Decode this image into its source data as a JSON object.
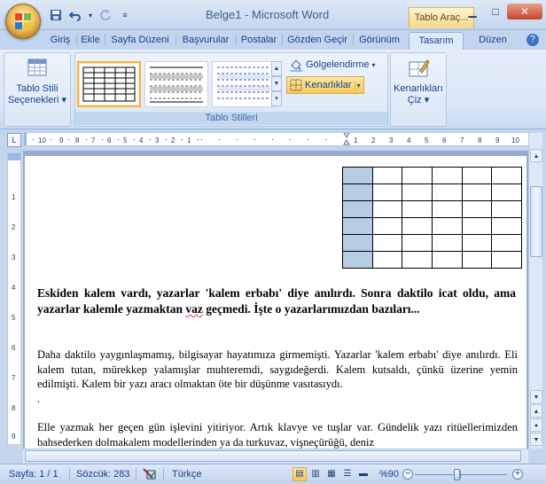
{
  "window": {
    "title": "Belge1 - Microsoft Word",
    "context_tab_group": "Tablo Araç..."
  },
  "tabs": [
    {
      "label": "Giriş"
    },
    {
      "label": "Ekle"
    },
    {
      "label": "Sayfa Düzeni"
    },
    {
      "label": "Başvurular"
    },
    {
      "label": "Postalar"
    },
    {
      "label": "Gözden Geçir"
    },
    {
      "label": "Görünüm"
    },
    {
      "label": "Tasarım",
      "active": true
    },
    {
      "label": "Düzen"
    }
  ],
  "ribbon": {
    "table_style_options_label": "Tablo Stili Seçenekleri",
    "shading_label": "Gölgelendirme",
    "borders_label": "Kenarlıklar",
    "draw_borders_label": "Kenarlıkları Çiz",
    "table_styles_group_label": "Tablo Stilleri"
  },
  "document": {
    "heading": "Eskiden kalem vardı, yazarlar 'kalem erbabı' diye anılırdı. Sonra daktilo icat oldu, ama yazarlar kalemle yazmaktan vaz geçmedi. İşte o yazarlarımızdan bazıları...",
    "heading_part1": "Eskiden kalem vardı, yazarlar 'kalem erbabı' diye anılırdı. Sonra daktilo icat oldu, ama yazarlar kalemle yazmaktan ",
    "heading_squiggle": "vaz",
    "heading_part2": " geçmedi. İşte o yazarlarımızdan bazıları...",
    "paragraph1": "Daha daktilo yaygınlaşmamış, bilgisayar hayatımıza girmemişti. Yazarlar 'kalem erbabı' diye anılırdı. Eli kalem tutan, mürekkep yalamışlar muhteremdi, saygıdeğerdi. Kalem kutsaldı, çünkü üzerine yemin edilmişti. Kalem bir yazı aracı olmaktan öte bir düşünme vasıtasıydı.",
    "paragraph1_tail": ".",
    "paragraph2": "Elle yazmak her geçen gün işlevini yitiriyor. Artık klavye ve tuşlar var. Gündelik yazı ritüellerimizden bahsederken dolmakalem modellerinden ya da turkuvaz, vişneçürüğü, deniz",
    "table": {
      "rows": 6,
      "cols": 6
    }
  },
  "statusbar": {
    "page": "Sayfa: 1 / 1",
    "words": "Sözcük: 283",
    "language": "Türkçe",
    "zoom": "%90",
    "zoom_value": 90
  },
  "colors": {
    "accent": "#15428b",
    "ribbon_bg": "#dbe7f6",
    "highlight": "#f8c958",
    "table_column_shade": "#b8cce4"
  },
  "icons": [
    "office-button-icon",
    "save-icon",
    "undo-icon",
    "redo-icon",
    "qat-dropdown-icon",
    "minimize-icon",
    "maximize-icon",
    "close-icon",
    "shading-icon",
    "borders-icon",
    "draw-borders-icon",
    "table-style-options-icon",
    "proofing-icon"
  ]
}
